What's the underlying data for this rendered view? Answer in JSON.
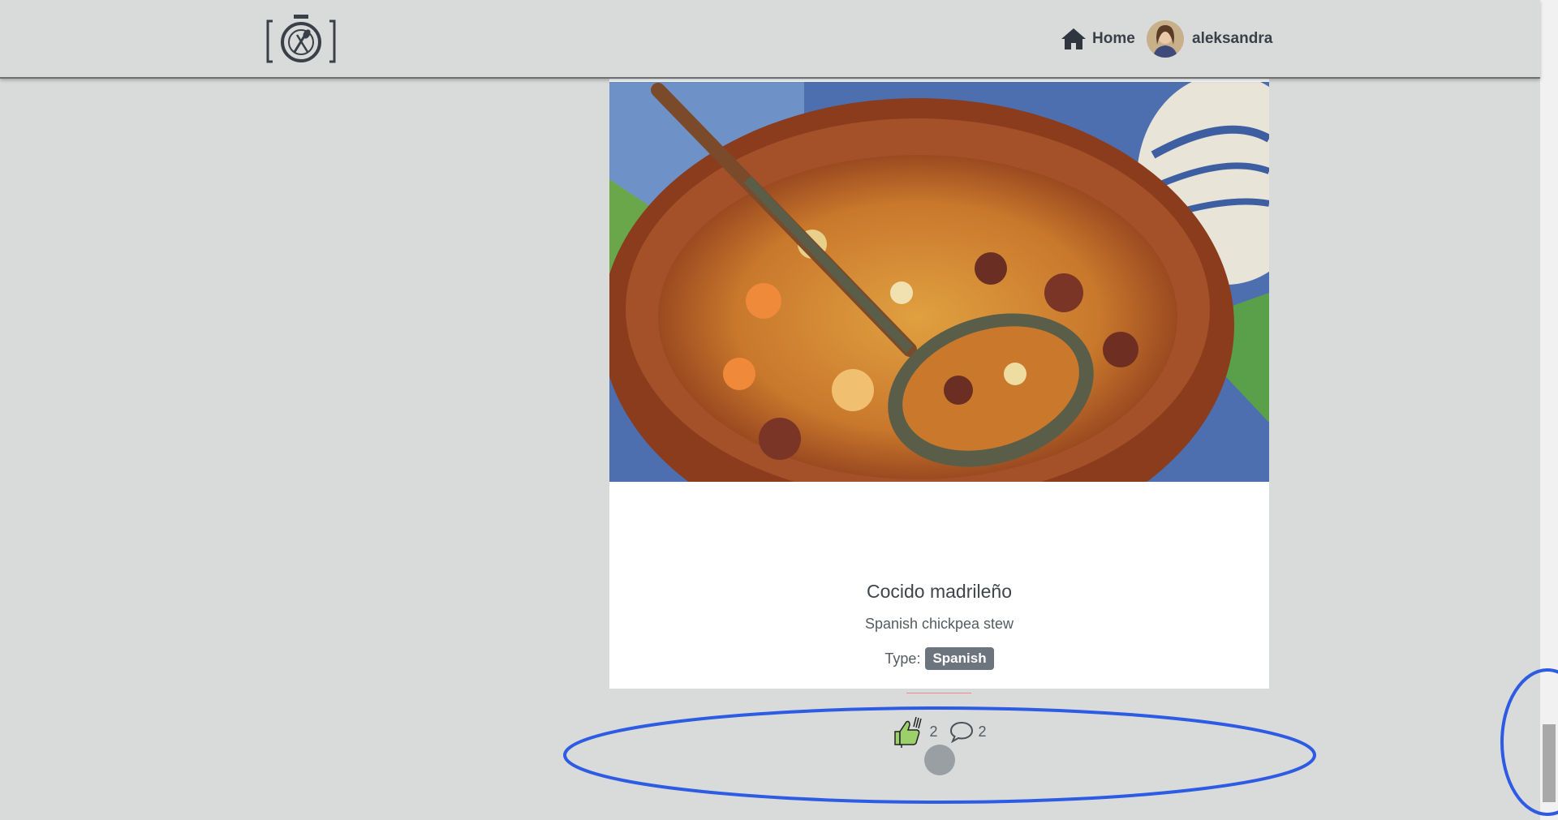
{
  "header": {
    "logo_icon": "camera-plate-cutlery-logo",
    "home_label": "Home",
    "home_icon": "home-icon",
    "user_name": "aleksandra"
  },
  "recipe": {
    "title": "Cocido madrileño",
    "subtitle": "Spanish chickpea stew",
    "type_label": "Type:",
    "type_value": "Spanish",
    "likes_count": "2",
    "comments_count": "2",
    "like_icon": "thumbs-up-fork-icon",
    "comment_icon": "speech-bubble-icon"
  },
  "colors": {
    "background": "#d9dbdb",
    "badge": "#6c757d",
    "annotation": "#2d5be3",
    "divider": "#e88a8a"
  }
}
